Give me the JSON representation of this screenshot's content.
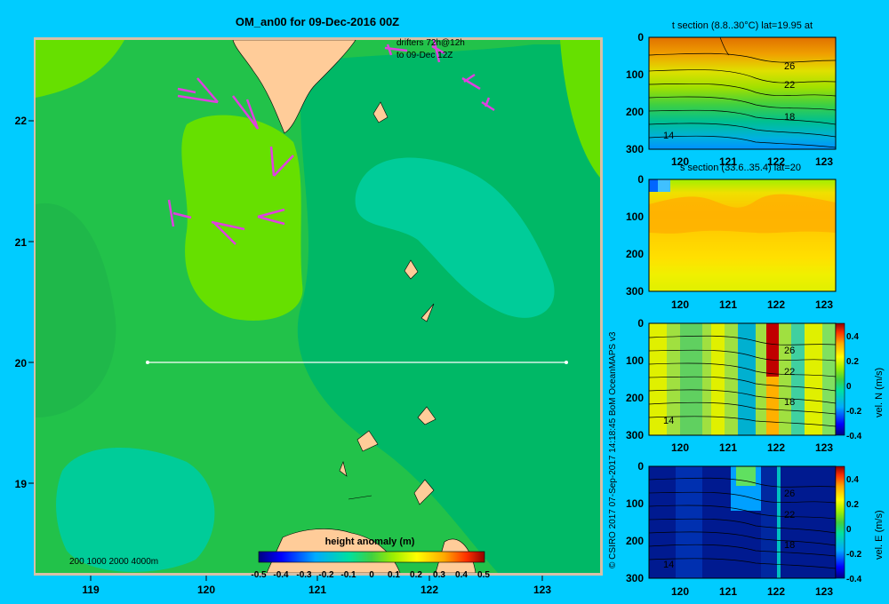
{
  "map": {
    "title": "OM_an00 for 09-Dec-2016 00Z",
    "drifters_line1": "drifters 72h@12h",
    "drifters_line2": "to 09-Dec 12Z",
    "lon_ticks": [
      "119",
      "120",
      "121",
      "122",
      "123"
    ],
    "lat_ticks": [
      "22",
      "21",
      "20",
      "19"
    ],
    "depth_legend": "200  1000  2000  4000m",
    "colorbar_title": "height anomaly  (m)",
    "colorbar_ticks": [
      "-0.5",
      "-0.4",
      "-0.3",
      "-0.2",
      "-0.1",
      "0",
      "0.1",
      "0.2",
      "0.3",
      "0.4",
      "0.5"
    ],
    "section_lat": 20,
    "section_lon_range": [
      119.5,
      123.2
    ]
  },
  "credit": "© CSIRO 2017   07-Sep-2017 14:18:45 BoM OceanMAPS v3",
  "panels": [
    {
      "title": "t section (8.8..30°C) lat=19.95 at",
      "contours": [
        "26",
        "22",
        "18",
        "14"
      ],
      "cbar": null
    },
    {
      "title": "s section (33.6..35.4) lat=20",
      "contours": [],
      "cbar": null
    },
    {
      "title": "",
      "contours": [
        "26",
        "22",
        "18",
        "14"
      ],
      "cbar": {
        "label": "vel. N (m/s)",
        "ticks": [
          "0.4",
          "0.2",
          "0",
          "-0.2",
          "-0.4"
        ]
      }
    },
    {
      "title": "",
      "contours": [
        "26",
        "22",
        "18",
        "14"
      ],
      "cbar": {
        "label": "vel. E (m/s)",
        "ticks": [
          "0.4",
          "0.2",
          "0",
          "-0.2",
          "-0.4"
        ]
      }
    }
  ],
  "panel_x_ticks": [
    "120",
    "121",
    "122",
    "123"
  ],
  "panel_y_ticks": [
    "0",
    "100",
    "200",
    "300"
  ],
  "colors": {
    "background": "#00ccff",
    "sea_dark": "#00b866",
    "sea_mid": "#22c24a",
    "sea_light": "#66e000",
    "sea_teal": "#00cc99",
    "land": "#ffcc99",
    "drifter": "#e040e0"
  }
}
